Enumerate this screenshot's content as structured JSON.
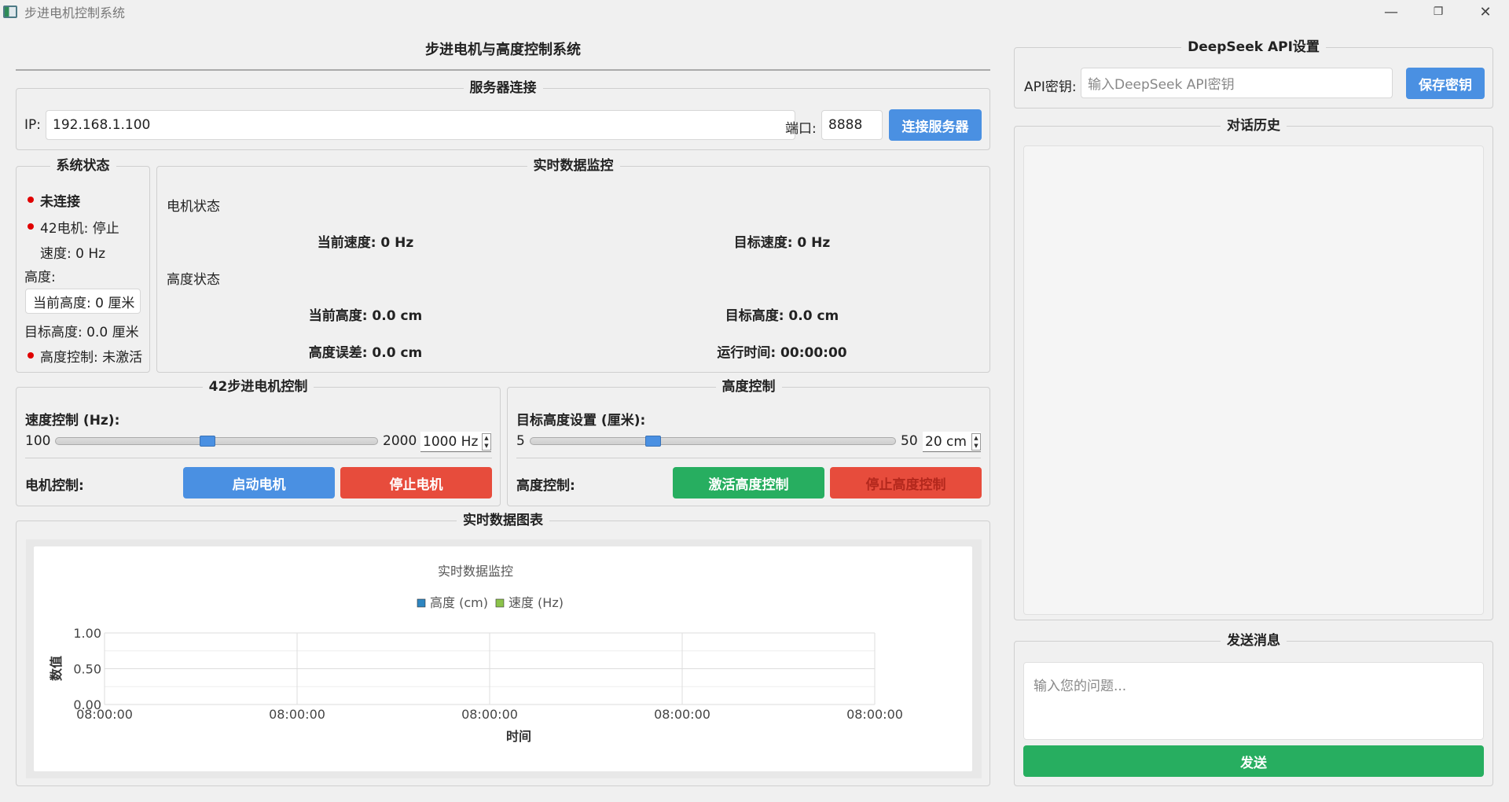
{
  "window": {
    "title": "步进电机控制系统",
    "minimize": "—",
    "restore": "❐",
    "close": "✕"
  },
  "header": {
    "title": "步进电机与高度控制系统"
  },
  "server": {
    "group_title": "服务器连接",
    "ip_label": "IP:",
    "ip_value": "192.168.1.100",
    "port_label": "端口:",
    "port_value": "8888",
    "connect_button": "连接服务器"
  },
  "system_status": {
    "group_title": "系统状态",
    "connection": "未连接",
    "motor": "42电机: 停止",
    "speed": "速度: 0 Hz",
    "height_label": "高度:",
    "current_height": "当前高度: 0 厘米",
    "target_height": "目标高度: 0.0 厘米",
    "height_control": "高度控制: 未激活",
    "status_color": "#e00000"
  },
  "monitor": {
    "group_title": "实时数据监控",
    "motor_section": "电机状态",
    "current_speed": "当前速度: 0 Hz",
    "target_speed": "目标速度: 0 Hz",
    "height_section": "高度状态",
    "current_height": "当前高度: 0.0 cm",
    "target_height": "目标高度: 0.0 cm",
    "height_error": "高度误差: 0.0 cm",
    "run_time": "运行时间: 00:00:00"
  },
  "motor_control": {
    "group_title": "42步进电机控制",
    "speed_label": "速度控制 (Hz):",
    "min": "100",
    "max": "2000",
    "value": "1000 Hz",
    "slider_fraction": 0.47,
    "control_label": "电机控制:",
    "start_button": "启动电机",
    "stop_button": "停止电机"
  },
  "height_control": {
    "group_title": "高度控制",
    "target_label": "目标高度设置 (厘米):",
    "min": "5",
    "max": "50",
    "value": "20 cm",
    "slider_fraction": 0.33,
    "control_label": "高度控制:",
    "activate_button": "激活高度控制",
    "stop_button": "停止高度控制"
  },
  "chart_panel": {
    "group_title": "实时数据图表"
  },
  "chart_data": {
    "type": "line",
    "title": "实时数据监控",
    "series": [
      {
        "name": "高度 (cm)",
        "color": "#2e86c1",
        "values": []
      },
      {
        "name": "速度 (Hz)",
        "color": "#8bc34a",
        "values": []
      }
    ],
    "x_ticks": [
      "08:00:00",
      "08:00:00",
      "08:00:00",
      "08:00:00",
      "08:00:00"
    ],
    "y_ticks": [
      "1.00",
      "0.50",
      "0.00"
    ],
    "ylim": [
      0,
      1
    ],
    "xlabel": "时间",
    "ylabel": "数值",
    "legend": "top-center",
    "grid": true
  },
  "deepseek": {
    "group_title": "DeepSeek API设置",
    "key_label": "API密钥:",
    "key_placeholder": "输入DeepSeek API密钥",
    "save_button": "保存密钥"
  },
  "history": {
    "group_title": "对话历史"
  },
  "send": {
    "group_title": "发送消息",
    "placeholder": "输入您的问题...",
    "send_button": "发送"
  }
}
